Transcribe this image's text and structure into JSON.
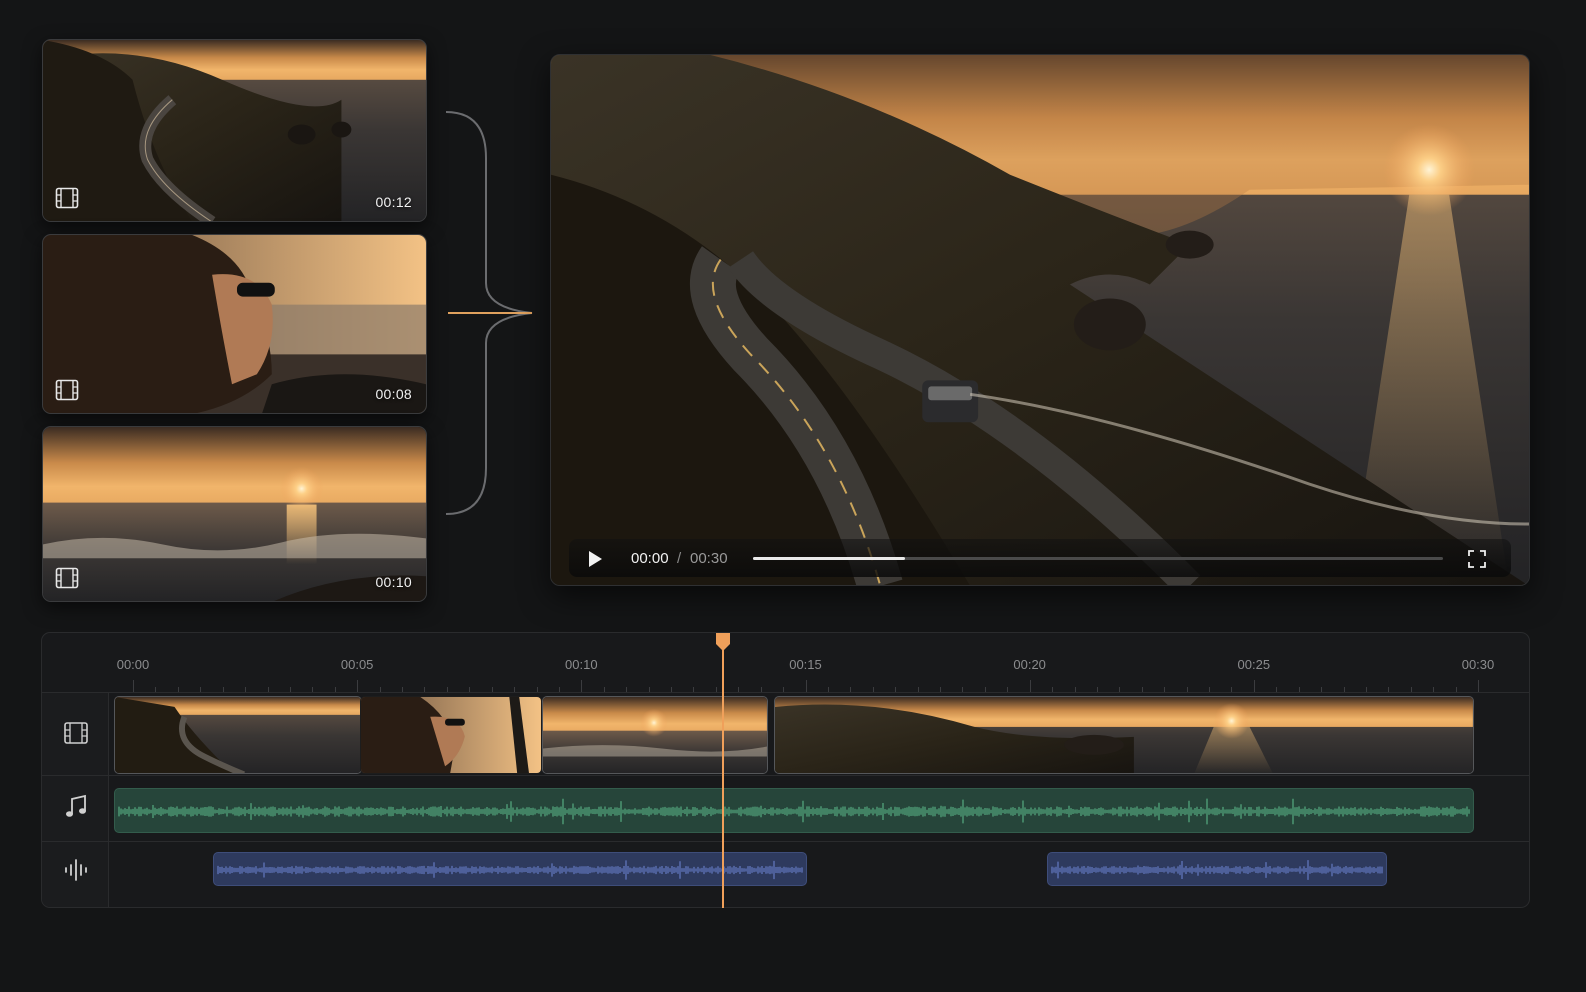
{
  "clips": [
    {
      "name": "coastal-road",
      "duration": "00:12"
    },
    {
      "name": "woman-in-car",
      "duration": "00:08"
    },
    {
      "name": "ocean-sunset",
      "duration": "00:10"
    }
  ],
  "player": {
    "current_time": "00:00",
    "separator": "/",
    "total_time": "00:30",
    "progress_fraction": 0.22
  },
  "timeline": {
    "ticks": [
      "00:00",
      "00:05",
      "00:10",
      "00:15",
      "00:20",
      "00:25",
      "00:30"
    ],
    "playhead_seconds": 13.6
  },
  "icons": {
    "clip_card": "film-icon",
    "play": "play-icon",
    "fullscreen": "fullscreen-icon",
    "video_track": "film-icon",
    "music_track": "music-note-icon",
    "voice_track": "voice-waveform-icon"
  },
  "colors": {
    "accent": "#f0a05a",
    "music_track": "#26453a",
    "music_wave": "#5fbf8e",
    "voice_track": "#2e3a5e",
    "voice_wave": "#6f86d6",
    "background": "#141516"
  }
}
